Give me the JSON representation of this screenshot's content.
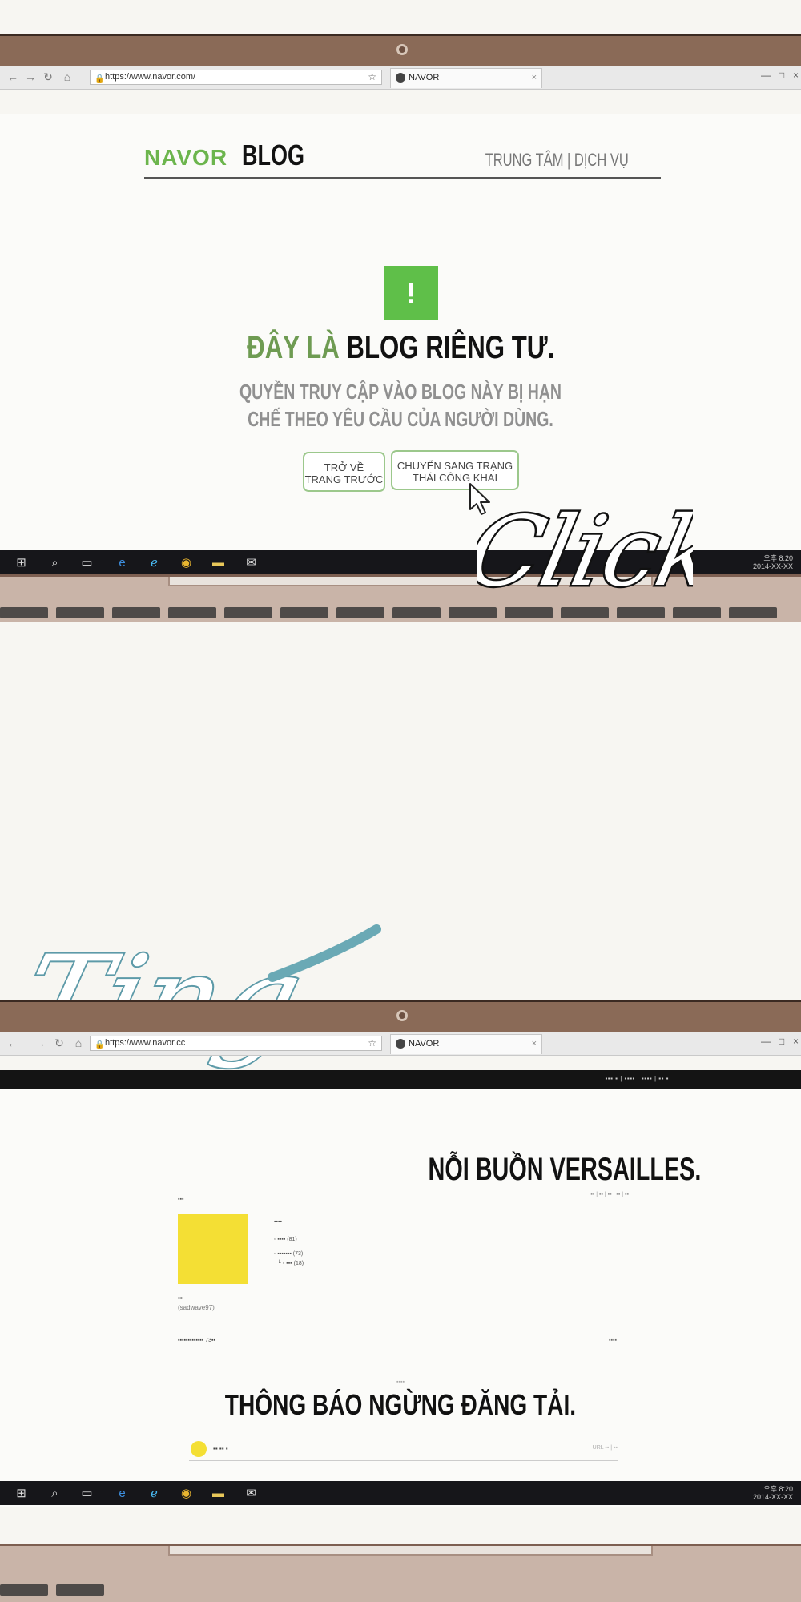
{
  "browser": {
    "url": "https://www.navor.com/",
    "url_truncated": "https://www.navor.cc",
    "tab_title": "NAVOR"
  },
  "panel1": {
    "logo_navor": "NAVOR",
    "logo_blog": "BLOG",
    "header_links": "TRUNG TÂM | DỊCH VỤ",
    "warning_glyph": "!",
    "title_green": "ĐÂY LÀ",
    "title_black": "BLOG RIÊNG TƯ.",
    "desc_line1": "QUYỀN TRUY CẬP VÀO BLOG NÀY BỊ HẠN",
    "desc_line2": "CHẾ THEO YÊU CẦU CỦA NGƯỜI DÙNG.",
    "btn_back_line1": "TRỞ VỀ",
    "btn_back_line2": "TRANG TRƯỚC",
    "btn_public_line1": "CHUYỂN SANG TRẠNG",
    "btn_public_line2": "THÁI CÔNG KHAI",
    "sfx": "Click"
  },
  "middle": {
    "sfx": "Ting"
  },
  "panel2": {
    "blog_title": "NỖI BUỒN VERSAILLES.",
    "post_title": "THÔNG BÁO NGỪNG ĐĂNG TẢI.",
    "profile_id": "(sadwave97)"
  },
  "taskbar": {
    "time": "오후 8:20",
    "date": "2014-XX-XX"
  },
  "colors": {
    "navor_green": "#6cb54d",
    "warning_green": "#5fbf49",
    "avatar_yellow": "#f4df34",
    "frame_brown": "#8a6a57"
  },
  "icons": [
    "back-icon",
    "forward-icon",
    "reload-icon",
    "home-icon",
    "lock-icon",
    "star-icon",
    "globe-icon",
    "close-icon",
    "windows-start-icon",
    "search-icon",
    "task-view-icon",
    "edge-icon",
    "ie-icon",
    "chrome-icon",
    "folder-icon",
    "mail-icon",
    "cursor-arrow-icon"
  ]
}
